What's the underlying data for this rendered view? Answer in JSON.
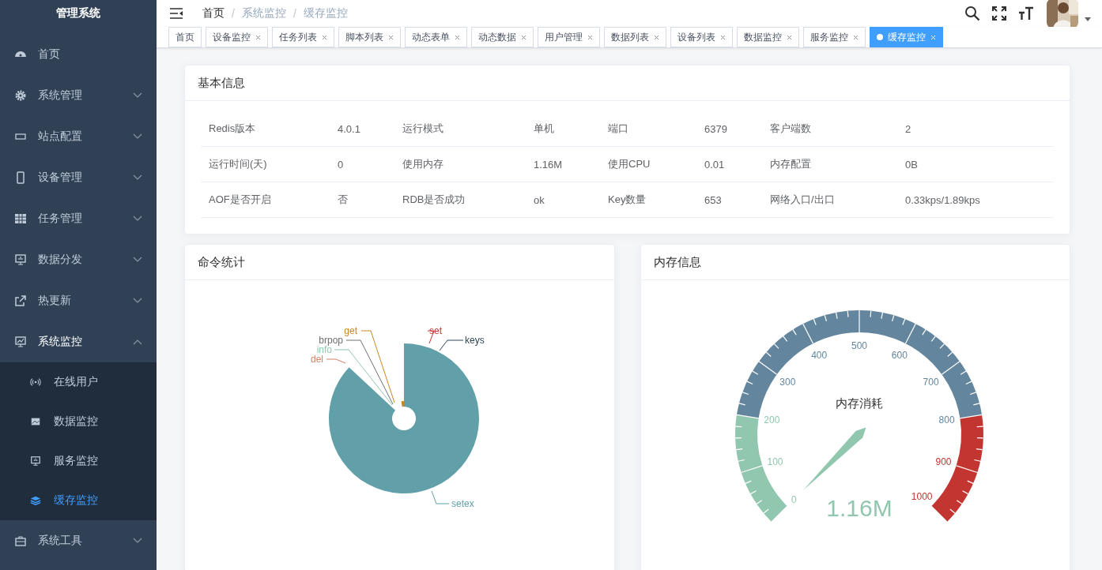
{
  "sidebar": {
    "title": "管理系统",
    "items": [
      {
        "label": "首页",
        "kind": "link"
      },
      {
        "label": "系统管理",
        "kind": "submenu",
        "expanded": false
      },
      {
        "label": "站点配置",
        "kind": "submenu",
        "expanded": false
      },
      {
        "label": "设备管理",
        "kind": "submenu",
        "expanded": false
      },
      {
        "label": "任务管理",
        "kind": "submenu",
        "expanded": false
      },
      {
        "label": "数据分发",
        "kind": "submenu",
        "expanded": false
      },
      {
        "label": "热更新",
        "kind": "submenu",
        "expanded": false
      },
      {
        "label": "系统监控",
        "kind": "submenu",
        "expanded": true,
        "children": [
          {
            "label": "在线用户",
            "selected": false
          },
          {
            "label": "数据监控",
            "selected": false
          },
          {
            "label": "服务监控",
            "selected": false
          },
          {
            "label": "缓存监控",
            "selected": true
          }
        ]
      },
      {
        "label": "系统工具",
        "kind": "submenu",
        "expanded": false
      }
    ]
  },
  "breadcrumb": [
    {
      "label": "首页",
      "current": false
    },
    {
      "separator": "/",
      "label": "系统监控",
      "current": true
    },
    {
      "separator": "/",
      "label": "缓存监控",
      "current": true
    }
  ],
  "tabs": [
    {
      "label": "首页",
      "selected": false,
      "closable": false
    },
    {
      "label": "设备监控",
      "selected": false,
      "closable": true
    },
    {
      "label": "任务列表",
      "selected": false,
      "closable": true
    },
    {
      "label": "脚本列表",
      "selected": false,
      "closable": true
    },
    {
      "label": "动态表单",
      "selected": false,
      "closable": true
    },
    {
      "label": "动态数据",
      "selected": false,
      "closable": true
    },
    {
      "label": "用户管理",
      "selected": false,
      "closable": true
    },
    {
      "label": "数据列表",
      "selected": false,
      "closable": true
    },
    {
      "label": "设备列表",
      "selected": false,
      "closable": true
    },
    {
      "label": "数据监控",
      "selected": false,
      "closable": true
    },
    {
      "label": "服务监控",
      "selected": false,
      "closable": true
    },
    {
      "label": "缓存监控",
      "selected": true,
      "closable": true
    }
  ],
  "basic_info": {
    "title": "基本信息",
    "rows": [
      [
        "Redis版本",
        "4.0.1",
        "运行模式",
        "单机",
        "端口",
        "6379",
        "客户端数",
        "2"
      ],
      [
        "运行时间(天)",
        "0",
        "使用内存",
        "1.16M",
        "使用CPU",
        "0.01",
        "内存配置",
        "0B"
      ],
      [
        "AOF是否开启",
        "否",
        "RDB是否成功",
        "ok",
        "Key数量",
        "653",
        "网络入口/出口",
        "0.33kps/1.89kps"
      ]
    ]
  },
  "command_stats": {
    "title": "命令统计",
    "labels": [
      {
        "name": "set",
        "color": "#c23531"
      },
      {
        "name": "keys",
        "color": "#2f4554"
      },
      {
        "name": "get",
        "color": "#ca8622"
      },
      {
        "name": "brpop",
        "color": "#6e7074"
      },
      {
        "name": "info",
        "color": "#91c7ae"
      },
      {
        "name": "del",
        "color": "#d48265"
      },
      {
        "name": "setex",
        "color": "#61a0a8"
      }
    ]
  },
  "memory": {
    "title": "内存信息",
    "gauge": {
      "title": "内存消耗",
      "value": "1.16M",
      "axis_labels": [
        "0",
        "100",
        "200",
        "300",
        "400",
        "500",
        "600",
        "700",
        "800",
        "900",
        "1000"
      ]
    }
  }
}
